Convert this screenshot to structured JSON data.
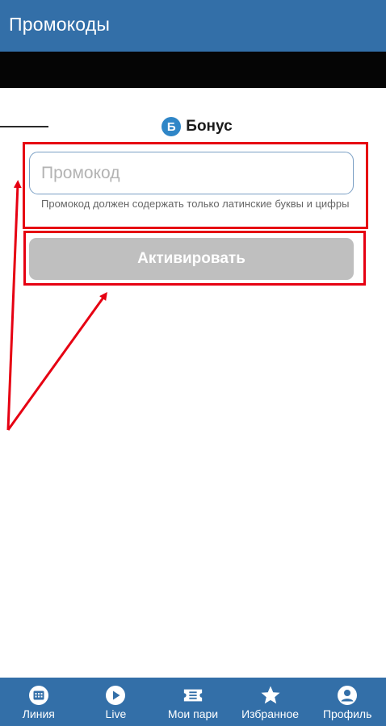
{
  "header": {
    "title": "Промокоды"
  },
  "logo": {
    "letter": "Б",
    "text": "Бонус"
  },
  "form": {
    "promo_placeholder": "Промокод",
    "promo_value": "",
    "hint": "Промокод должен содержать только латинские буквы и цифры",
    "activate_label": "Активировать"
  },
  "nav": {
    "items": [
      {
        "label": "Линия",
        "icon": "calendar-icon"
      },
      {
        "label": "Live",
        "icon": "play-icon"
      },
      {
        "label": "Мои пари",
        "icon": "ticket-icon"
      },
      {
        "label": "Избранное",
        "icon": "star-icon"
      },
      {
        "label": "Профиль",
        "icon": "profile-icon"
      }
    ]
  },
  "colors": {
    "header": "#336fa8",
    "annotation": "#e60012",
    "button_disabled": "#bfbfbf",
    "logo": "#2f86c7"
  }
}
